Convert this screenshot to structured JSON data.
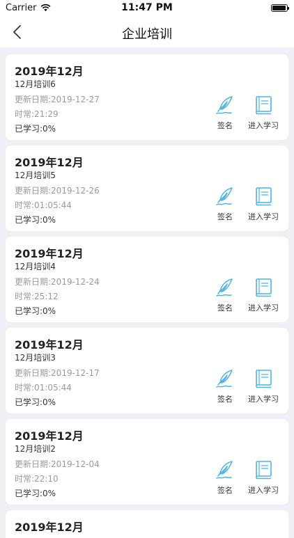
{
  "status_bar": {
    "carrier": "Carrier",
    "time": "11:47 PM",
    "icons": [
      "wifi-icon",
      "battery-icon"
    ]
  },
  "nav": {
    "title": "企业培训",
    "back_icon": "chevron-left-icon"
  },
  "colors": {
    "accent": "#4ab4e6",
    "background": "#eef0f5",
    "secondary_text": "#9a9a9a"
  },
  "actions": {
    "sign_label": "签名",
    "sign_icon": "quill-pen-icon",
    "study_label": "进入学习",
    "study_icon": "book-icon"
  },
  "trainings": [
    {
      "month": "2019年12月",
      "name": "12月培训6",
      "date": "更新日期:2019-12-27",
      "duration": "时常:21:29",
      "progress": "已学习:0%"
    },
    {
      "month": "2019年12月",
      "name": "12月培训5",
      "date": "更新日期:2019-12-26",
      "duration": "时常:01:05:44",
      "progress": "已学习:0%"
    },
    {
      "month": "2019年12月",
      "name": "12月培训4",
      "date": "更新日期:2019-12-24",
      "duration": "时常:25:12",
      "progress": "已学习:0%"
    },
    {
      "month": "2019年12月",
      "name": "12月培训3",
      "date": "更新日期:2019-12-17",
      "duration": "时常:01:05:44",
      "progress": "已学习:0%"
    },
    {
      "month": "2019年12月",
      "name": "12月培训2",
      "date": "更新日期:2019-12-04",
      "duration": "时常:22:10",
      "progress": "已学习:0%"
    }
  ],
  "partial_card": {
    "month": "2019年12月"
  }
}
